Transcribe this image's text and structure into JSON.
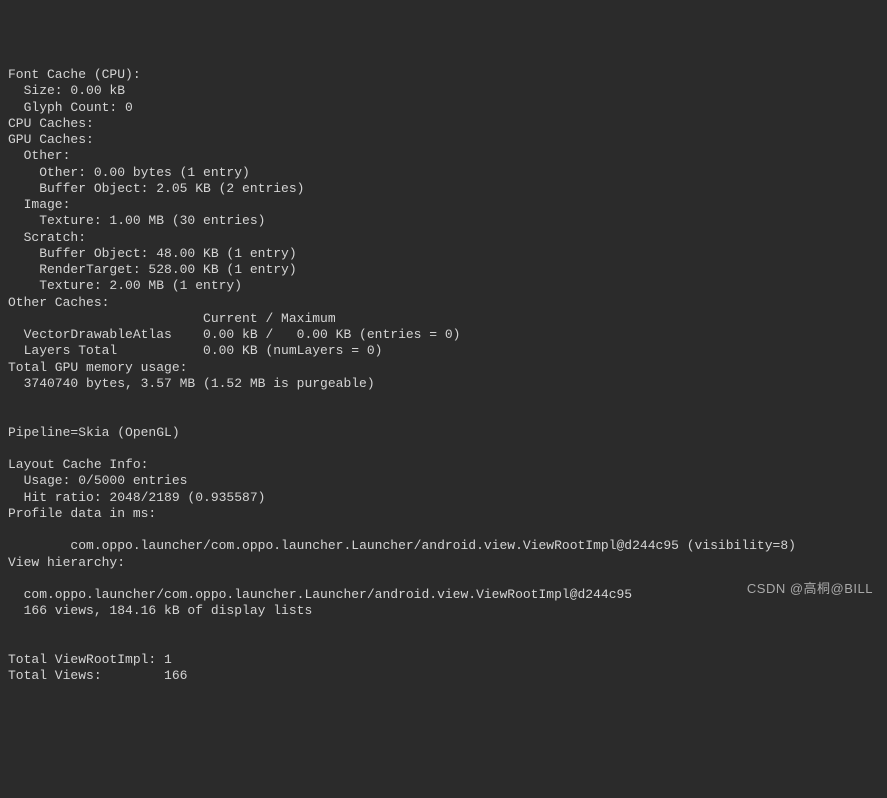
{
  "terminal": {
    "lines": [
      "Font Cache (CPU):",
      "  Size: 0.00 kB",
      "  Glyph Count: 0",
      "CPU Caches:",
      "GPU Caches:",
      "  Other:",
      "    Other: 0.00 bytes (1 entry)",
      "    Buffer Object: 2.05 KB (2 entries)",
      "  Image:",
      "    Texture: 1.00 MB (30 entries)",
      "  Scratch:",
      "    Buffer Object: 48.00 KB (1 entry)",
      "    RenderTarget: 528.00 KB (1 entry)",
      "    Texture: 2.00 MB (1 entry)",
      "Other Caches:",
      "                         Current / Maximum",
      "  VectorDrawableAtlas    0.00 kB /   0.00 KB (entries = 0)",
      "  Layers Total           0.00 KB (numLayers = 0)",
      "Total GPU memory usage:",
      "  3740740 bytes, 3.57 MB (1.52 MB is purgeable)",
      "",
      "",
      "Pipeline=Skia (OpenGL)",
      "",
      "Layout Cache Info:",
      "  Usage: 0/5000 entries",
      "  Hit ratio: 2048/2189 (0.935587)",
      "Profile data in ms:",
      "",
      "\tcom.oppo.launcher/com.oppo.launcher.Launcher/android.view.ViewRootImpl@d244c95 (visibility=8)",
      "View hierarchy:",
      "",
      "  com.oppo.launcher/com.oppo.launcher.Launcher/android.view.ViewRootImpl@d244c95",
      "  166 views, 184.16 kB of display lists",
      "",
      "",
      "Total ViewRootImpl: 1",
      "Total Views:        166"
    ]
  },
  "watermark": {
    "text": "CSDN @高桐@BILL"
  }
}
